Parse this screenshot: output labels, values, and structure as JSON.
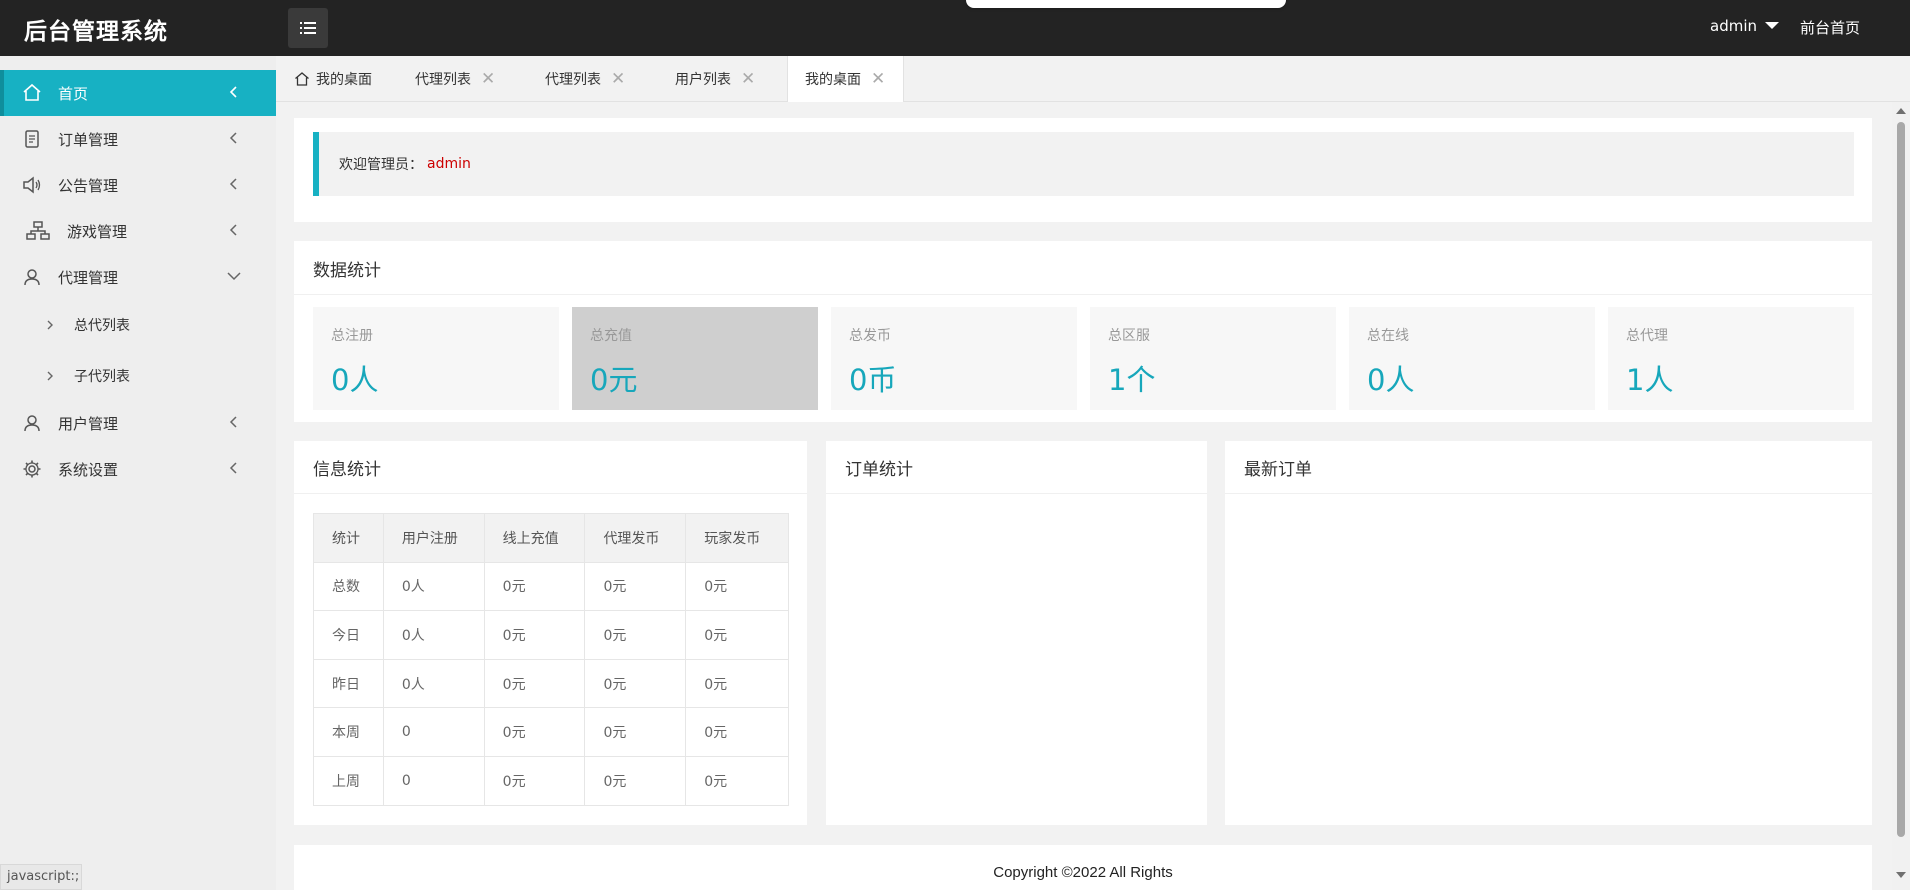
{
  "header": {
    "title": "后台管理系统",
    "username": "admin",
    "frontend_link": "前台首页"
  },
  "sidebar": {
    "items": [
      {
        "label": "首页",
        "icon": "home-icon",
        "active": true
      },
      {
        "label": "订单管理",
        "icon": "document-icon"
      },
      {
        "label": "公告管理",
        "icon": "speaker-icon"
      },
      {
        "label": "游戏管理",
        "icon": "sitemap-icon"
      },
      {
        "label": "代理管理",
        "icon": "user-icon",
        "expanded": true
      },
      {
        "label": "用户管理",
        "icon": "user-icon"
      },
      {
        "label": "系统设置",
        "icon": "gear-icon"
      }
    ],
    "subitems": [
      {
        "label": "总代列表"
      },
      {
        "label": "子代列表"
      }
    ]
  },
  "status_hint": "javascript:;",
  "tabs": [
    {
      "label": "我的桌面",
      "icon": "home-icon",
      "closable": false
    },
    {
      "label": "代理列表",
      "closable": true
    },
    {
      "label": "代理列表",
      "closable": true
    },
    {
      "label": "用户列表",
      "closable": true
    },
    {
      "label": "我的桌面",
      "closable": true,
      "active": true
    }
  ],
  "tab_close_glyph": "✕",
  "welcome": {
    "prefix": "欢迎管理员：",
    "name": "admin"
  },
  "data_stats": {
    "title": "数据统计",
    "items": [
      {
        "label": "总注册",
        "value": "0人"
      },
      {
        "label": "总充值",
        "value": "0元"
      },
      {
        "label": "总发币",
        "value": "0币"
      },
      {
        "label": "总区服",
        "value": "1个"
      },
      {
        "label": "总在线",
        "value": "0人"
      },
      {
        "label": "总代理",
        "value": "1人"
      }
    ]
  },
  "info_stats": {
    "title": "信息统计",
    "headers": [
      "统计",
      "用户注册",
      "线上充值",
      "代理发币",
      "玩家发币"
    ],
    "rows": [
      [
        "总数",
        "0人",
        "0元",
        "0元",
        "0元"
      ],
      [
        "今日",
        "0人",
        "0元",
        "0元",
        "0元"
      ],
      [
        "昨日",
        "0人",
        "0元",
        "0元",
        "0元"
      ],
      [
        "本周",
        "0",
        "0元",
        "0元",
        "0元"
      ],
      [
        "上周",
        "0",
        "0元",
        "0元",
        "0元"
      ]
    ]
  },
  "order_stats": {
    "title": "订单统计"
  },
  "latest_orders": {
    "title": "最新订单"
  },
  "footer": {
    "copyright": "Copyright ©2022 All Rights"
  },
  "colors": {
    "accent": "#17b1c3",
    "header_bg": "#232323",
    "stat_value": "#17a7bb",
    "admin_name": "#cc0000"
  }
}
